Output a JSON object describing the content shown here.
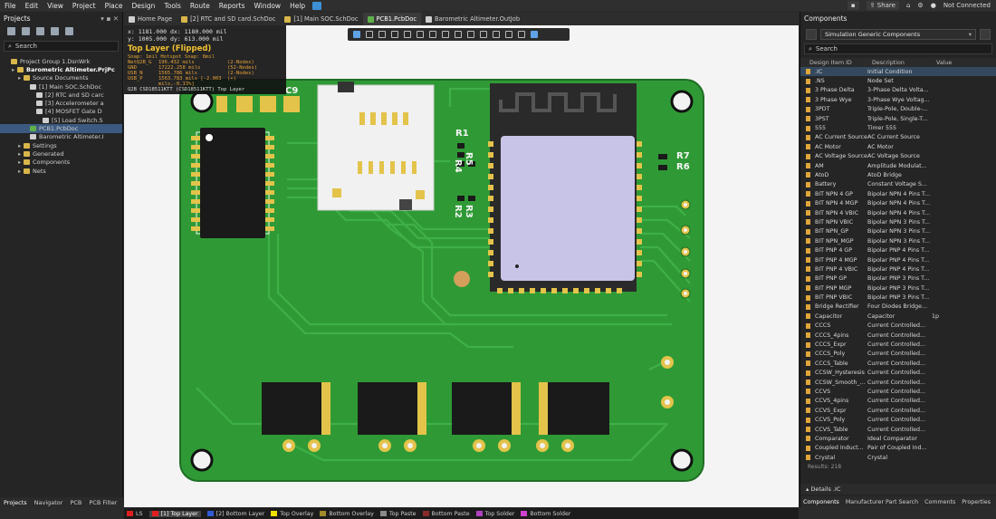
{
  "menu": {
    "items": [
      "File",
      "Edit",
      "View",
      "Project",
      "Place",
      "Design",
      "Tools",
      "Route",
      "Reports",
      "Window",
      "Help"
    ],
    "share_label": "Share",
    "connection_status": "Not Connected"
  },
  "projects_panel": {
    "title": "Projects",
    "search_placeholder": "Search",
    "tree": [
      {
        "label": "Project Group 1.DsnWrk",
        "level": 0,
        "icon": "workspace",
        "bold": false
      },
      {
        "label": "Barometric Altimeter.PrjPc",
        "level": 1,
        "icon": "project",
        "bold": true
      },
      {
        "label": "Source Documents",
        "level": 2,
        "icon": "folder",
        "bold": false
      },
      {
        "label": "[1] Main SOC.SchDoc",
        "level": 3,
        "icon": "doc",
        "bold": false
      },
      {
        "label": "[2] RTC and SD carc",
        "level": 4,
        "icon": "doc",
        "bold": false
      },
      {
        "label": "[3] Accelerometer a",
        "level": 4,
        "icon": "doc",
        "bold": false
      },
      {
        "label": "[4] MOSFET Gate D",
        "level": 4,
        "icon": "doc",
        "bold": false
      },
      {
        "label": "[5] Load Switch.S",
        "level": 5,
        "icon": "doc",
        "bold": false
      },
      {
        "label": "PCB1.PcbDoc",
        "level": 3,
        "icon": "pcb",
        "bold": false,
        "selected": true
      },
      {
        "label": "Barometric Altimeter.I",
        "level": 3,
        "icon": "doc",
        "bold": false
      },
      {
        "label": "Settings",
        "level": 2,
        "icon": "folder",
        "bold": false
      },
      {
        "label": "Generated",
        "level": 2,
        "icon": "folder",
        "bold": false
      },
      {
        "label": "Components",
        "level": 2,
        "icon": "folder",
        "bold": false
      },
      {
        "label": "Nets",
        "level": 2,
        "icon": "folder",
        "bold": false
      }
    ],
    "bottom_tabs": [
      "Projects",
      "Navigator",
      "PCB",
      "PCB Filter"
    ]
  },
  "doc_tabs": [
    {
      "label": "Home Page",
      "active": false
    },
    {
      "label": "[2] RTC and SD card.SchDoc",
      "active": false
    },
    {
      "label": "[1] Main SOC.SchDoc",
      "active": false
    },
    {
      "label": "PCB1.PcbDoc",
      "active": true
    },
    {
      "label": "Barometric Altimeter.OutJob",
      "active": false
    }
  ],
  "hud": {
    "x_line": "x:  1181.000   dx:  1180.000 mil",
    "y_line": "y:  1005.000   dy:   613.000 mil",
    "layer": "Top Layer (Flipped)",
    "snap": "Snap: 1mil Hotspot Snap: 8mil",
    "nets": [
      {
        "name": "NetQ2B_G",
        "length": "196.432 mils",
        "nodes": "(2-Nodes)"
      },
      {
        "name": "GND",
        "length": "17222.258 mils",
        "nodes": "(52-Nodes)"
      },
      {
        "name": "USB_N",
        "length": "1565.786 mils",
        "nodes": "(2-Nodes)"
      },
      {
        "name": "USB_P",
        "length": "1563.783 mils [-2.003 mils,-0.13%]",
        "nodes": "(+)"
      }
    ],
    "component": "Q2B CSD18511KTT (CSD18511KTT) Top Layer"
  },
  "pcb_labels": {
    "c9": "C9",
    "r1": "R1",
    "r4": "R4",
    "r5": "R5",
    "r2": "R2",
    "r3": "R3",
    "r7": "R7",
    "r6": "R6"
  },
  "components_panel": {
    "title": "Components",
    "library": "Simulation Generic Components",
    "search_placeholder": "Search",
    "columns": [
      "Design Item ID",
      "Description",
      "Value"
    ],
    "rows": [
      {
        "id": ".IC",
        "desc": "Initial Condition",
        "value": "",
        "selected": true
      },
      {
        "id": ".NS",
        "desc": "Node Set",
        "value": ""
      },
      {
        "id": "3 Phase Delta",
        "desc": "3-Phase Delta Volta...",
        "value": ""
      },
      {
        "id": "3 Phase Wye",
        "desc": "3-Phase Wye Voltag...",
        "value": ""
      },
      {
        "id": "3PDT",
        "desc": "Triple-Pole, Double-...",
        "value": ""
      },
      {
        "id": "3PST",
        "desc": "Triple-Pole, Single-T...",
        "value": ""
      },
      {
        "id": "555",
        "desc": "Timer 555",
        "value": ""
      },
      {
        "id": "AC Current Source",
        "desc": "AC Current Source",
        "value": ""
      },
      {
        "id": "AC Motor",
        "desc": "AC Motor",
        "value": ""
      },
      {
        "id": "AC Voltage Source",
        "desc": "AC Voltage Source",
        "value": ""
      },
      {
        "id": "AM",
        "desc": "Amplitude Modulat...",
        "value": ""
      },
      {
        "id": "AtoD",
        "desc": "AtoD Bridge",
        "value": ""
      },
      {
        "id": "Battery",
        "desc": "Constant Voltage S...",
        "value": ""
      },
      {
        "id": "BIT NPN 4 GP",
        "desc": "Bipolar NPN 4 Pins T...",
        "value": ""
      },
      {
        "id": "BIT NPN 4 MGP",
        "desc": "Bipolar NPN 4 Pins T...",
        "value": ""
      },
      {
        "id": "BIT NPN 4 VBIC",
        "desc": "Bipolar NPN 4 Pins T...",
        "value": ""
      },
      {
        "id": "BIT NPN VBIC",
        "desc": "Bipolar NPN 3 Pins T...",
        "value": ""
      },
      {
        "id": "BIT NPN_GP",
        "desc": "Bipolar NPN 3 Pins T...",
        "value": ""
      },
      {
        "id": "BIT NPN_MGP",
        "desc": "Bipolar NPN 3 Pins T...",
        "value": ""
      },
      {
        "id": "BIT PNP 4 GP",
        "desc": "Bipolar PNP 4 Pins T...",
        "value": ""
      },
      {
        "id": "BIT PNP 4 MGP",
        "desc": "Bipolar PNP 4 Pins T...",
        "value": ""
      },
      {
        "id": "BIT PNP 4 VBIC",
        "desc": "Bipolar PNP 4 Pins T...",
        "value": ""
      },
      {
        "id": "BIT PNP GP",
        "desc": "Bipolar PNP 3 Pins T...",
        "value": ""
      },
      {
        "id": "BIT PNP MGP",
        "desc": "Bipolar PNP 3 Pins T...",
        "value": ""
      },
      {
        "id": "BIT PNP VBIC",
        "desc": "Bipolar PNP 3 Pins T...",
        "value": ""
      },
      {
        "id": "Bridge Rectifier",
        "desc": "Four Diodes Bridge...",
        "value": ""
      },
      {
        "id": "Capacitor",
        "desc": "Capacitor",
        "value": "1p"
      },
      {
        "id": "CCCS",
        "desc": "Current Controlled...",
        "value": ""
      },
      {
        "id": "CCCS_4pins",
        "desc": "Current Controlled...",
        "value": ""
      },
      {
        "id": "CCCS_Expr",
        "desc": "Current Controlled...",
        "value": ""
      },
      {
        "id": "CCCS_Poly",
        "desc": "Current Controlled...",
        "value": ""
      },
      {
        "id": "CCCS_Table",
        "desc": "Current Controlled...",
        "value": ""
      },
      {
        "id": "CCSW_Hysteresis",
        "desc": "Current Controlled...",
        "value": ""
      },
      {
        "id": "CCSW_Smooth_...",
        "desc": "Current Controlled...",
        "value": ""
      },
      {
        "id": "CCVS",
        "desc": "Current Controlled...",
        "value": ""
      },
      {
        "id": "CCVS_4pins",
        "desc": "Current Controlled...",
        "value": ""
      },
      {
        "id": "CCVS_Expr",
        "desc": "Current Controlled...",
        "value": ""
      },
      {
        "id": "CCVS_Poly",
        "desc": "Current Controlled...",
        "value": ""
      },
      {
        "id": "CCVS_Table",
        "desc": "Current Controlled...",
        "value": ""
      },
      {
        "id": "Comparator",
        "desc": "Ideal Comparator",
        "value": ""
      },
      {
        "id": "Coupled Induct...",
        "desc": "Pair of Coupled Ind...",
        "value": ""
      },
      {
        "id": "Crystal",
        "desc": "Crystal",
        "value": ""
      }
    ],
    "results": "Results: 218",
    "details_label": "Details  .IC",
    "bottom_tabs": [
      "Components",
      "Manufacturer Part Search",
      "Comments",
      "Properties"
    ]
  },
  "layer_bar": [
    {
      "label": "LS",
      "color": "#e02020"
    },
    {
      "label": "[1] Top Layer",
      "color": "#e02020",
      "active": true
    },
    {
      "label": "[2] Bottom Layer",
      "color": "#2f5bd6"
    },
    {
      "label": "Top Overlay",
      "color": "#f0e000"
    },
    {
      "label": "Bottom Overlay",
      "color": "#a08a2a"
    },
    {
      "label": "Top Paste",
      "color": "#8a8a8a"
    },
    {
      "label": "Bottom Paste",
      "color": "#8a2a2a"
    },
    {
      "label": "Top Solder",
      "color": "#b040c0"
    },
    {
      "label": "Bottom Solder",
      "color": "#d040d0"
    }
  ],
  "colors": {
    "pcb_green": "#2f9a35",
    "pad_gold": "#e3c34a",
    "silkscreen": "#f5f5f5"
  }
}
